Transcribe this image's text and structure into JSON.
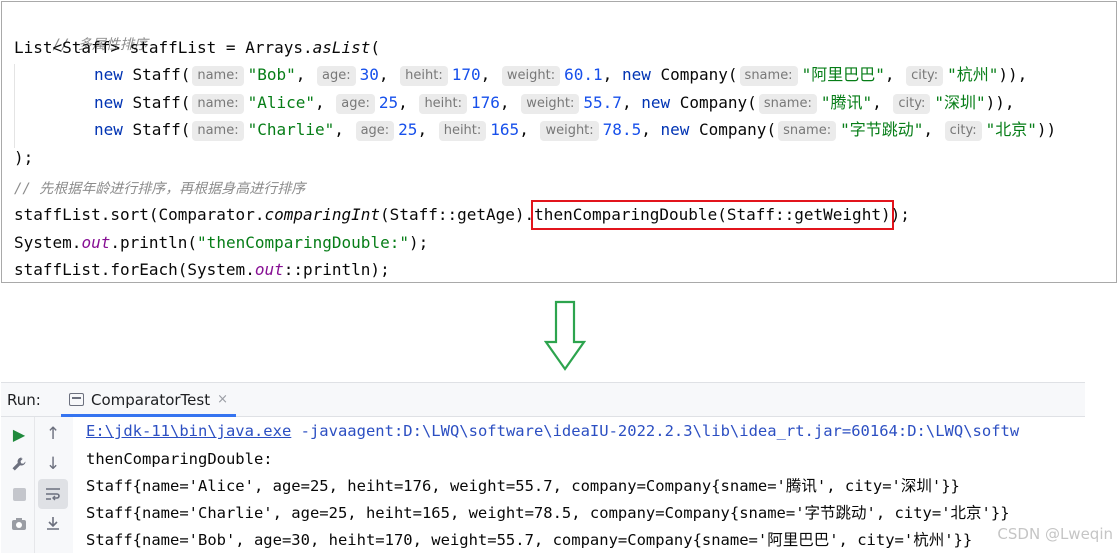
{
  "code": {
    "comment1": "// 多属性排序",
    "decl_type": "List<Staff> staffList = Arrays.",
    "decl_method": "asList",
    "decl_open": "(",
    "staff_rows": [
      {
        "new_kw": "new",
        "ctor": " Staff(",
        "hint_name": "name:",
        "name": "\"Bob\"",
        "hint_age": "age:",
        "age": "30",
        "hint_heiht": "heiht:",
        "heiht": "170",
        "hint_weight": "weight:",
        "weight": "60.1",
        "company_new": "new",
        "company_ctor": " Company(",
        "hint_sname": "sname:",
        "sname": "\"阿里巴巴\"",
        "hint_city": "city:",
        "city": "\"杭州\"",
        "tail": ")),"
      },
      {
        "new_kw": "new",
        "ctor": " Staff(",
        "hint_name": "name:",
        "name": "\"Alice\"",
        "hint_age": "age:",
        "age": "25",
        "hint_heiht": "heiht:",
        "heiht": "176",
        "hint_weight": "weight:",
        "weight": "55.7",
        "company_new": "new",
        "company_ctor": " Company(",
        "hint_sname": "sname:",
        "sname": "\"腾讯\"",
        "hint_city": "city:",
        "city": "\"深圳\"",
        "tail": ")),"
      },
      {
        "new_kw": "new",
        "ctor": " Staff(",
        "hint_name": "name:",
        "name": "\"Charlie\"",
        "hint_age": "age:",
        "age": "25",
        "hint_heiht": "heiht:",
        "heiht": "165",
        "hint_weight": "weight:",
        "weight": "78.5",
        "company_new": "new",
        "company_ctor": " Company(",
        "hint_sname": "sname:",
        "sname": "\"字节跳动\"",
        "hint_city": "city:",
        "city": "\"北京\"",
        "tail": "))"
      }
    ],
    "decl_close": ");",
    "comment2": "// 先根据年龄进行排序，再根据身高进行排序",
    "sort_pre": "staffList.sort(Comparator.",
    "sort_method": "comparingInt",
    "sort_mid": "(Staff::getAge).",
    "sort_highlight": "thenComparingDouble(Staff::getWeight)",
    "sort_end": ");",
    "print_pre": "System.",
    "print_out": "out",
    "print_mid": ".println(",
    "print_str": "\"thenComparingDouble:\"",
    "print_end": ");",
    "foreach_pre": "staffList.forEach(System.",
    "foreach_out": "out",
    "foreach_end": "::println);"
  },
  "run_panel": {
    "label": "Run:",
    "tab_label": "ComparatorTest",
    "tab_close": "×",
    "console_lines": {
      "cmd_link": "E:\\jdk-11\\bin\\java.exe",
      "cmd_rest": " -javaagent:D:\\LWQ\\software\\ideaIU-2022.2.3\\lib\\idea_rt.jar=60164:D:\\LWQ\\softw",
      "header": "thenComparingDouble:",
      "out1": "Staff{name='Alice', age=25, heiht=176, weight=55.7, company=Company{sname='腾讯', city='深圳'}}",
      "out2": "Staff{name='Charlie', age=25, heiht=165, weight=78.5, company=Company{sname='字节跳动', city='北京'}}",
      "out3": "Staff{name='Bob', age=30, heiht=170, weight=55.7, company=Company{sname='阿里巴巴', city='杭州'}}"
    },
    "tools_left": [
      "play-icon",
      "wrench-icon",
      "stop-icon",
      "camera-icon"
    ],
    "tools_right": [
      "arrow-up-icon",
      "arrow-down-icon",
      "soft-wrap-icon",
      "scroll-to-end-icon"
    ]
  },
  "watermark": "CSDN @Lweqin",
  "colors": {
    "keyword": "#0033b3",
    "string": "#067d17",
    "number": "#1750eb",
    "comment": "#8c8c8c",
    "highlight_box": "#e2141c",
    "arrow": "#2da44e"
  }
}
